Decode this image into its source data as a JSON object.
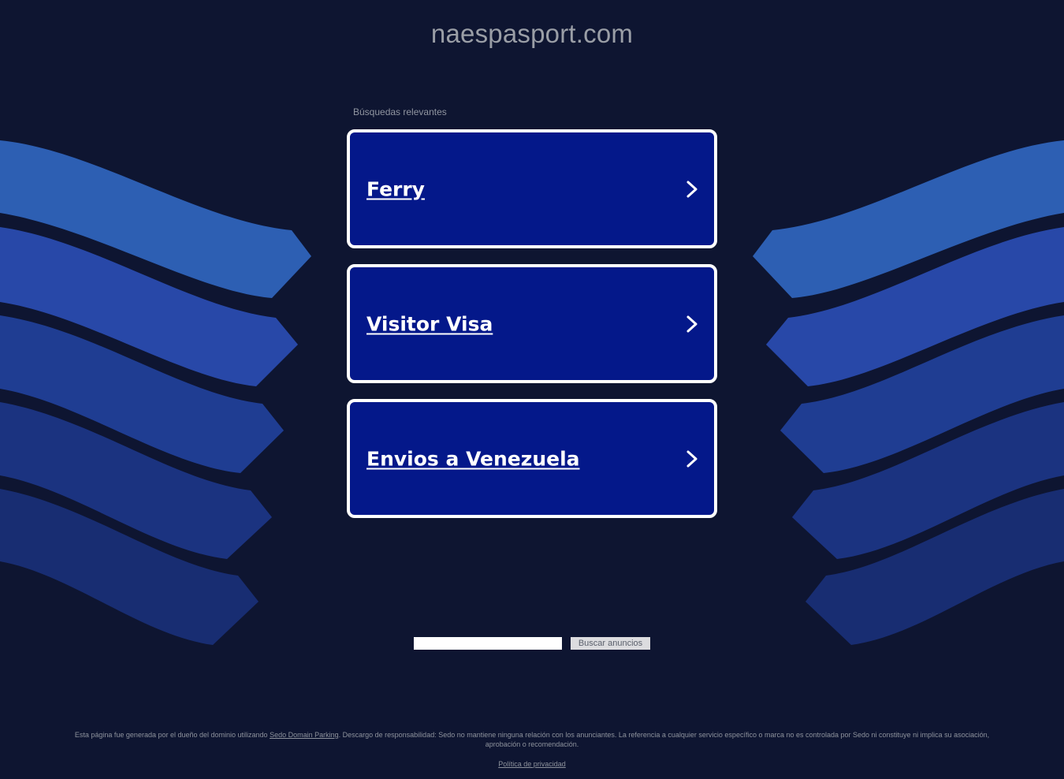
{
  "header": {
    "domain": "naespasport.com"
  },
  "related": {
    "label": "Búsquedas relevantes",
    "items": [
      {
        "label": "Ferry"
      },
      {
        "label": "Visitor Visa"
      },
      {
        "label": "Envios a Venezuela"
      }
    ]
  },
  "search": {
    "input_value": "",
    "button_label": "Buscar anuncios"
  },
  "footer": {
    "text_before": "Esta página fue generada por el dueño del dominio utilizando ",
    "link_label": "Sedo Domain Parking",
    "text_after": ". Descargo de responsabilidad: Sedo no mantiene ninguna relación con los anunciantes. La referencia a cualquier servicio específico o marca no es controlada por Sedo ni constituye ni implica su asociación, aprobación o recomendación.",
    "privacy_label": "Política de privacidad"
  },
  "colors": {
    "background": "#0e1531",
    "card": "#04188a",
    "wave_light": "#2d5fb3",
    "wave_mid": "#2848a8",
    "wave_dark": "#1e3a8a"
  }
}
